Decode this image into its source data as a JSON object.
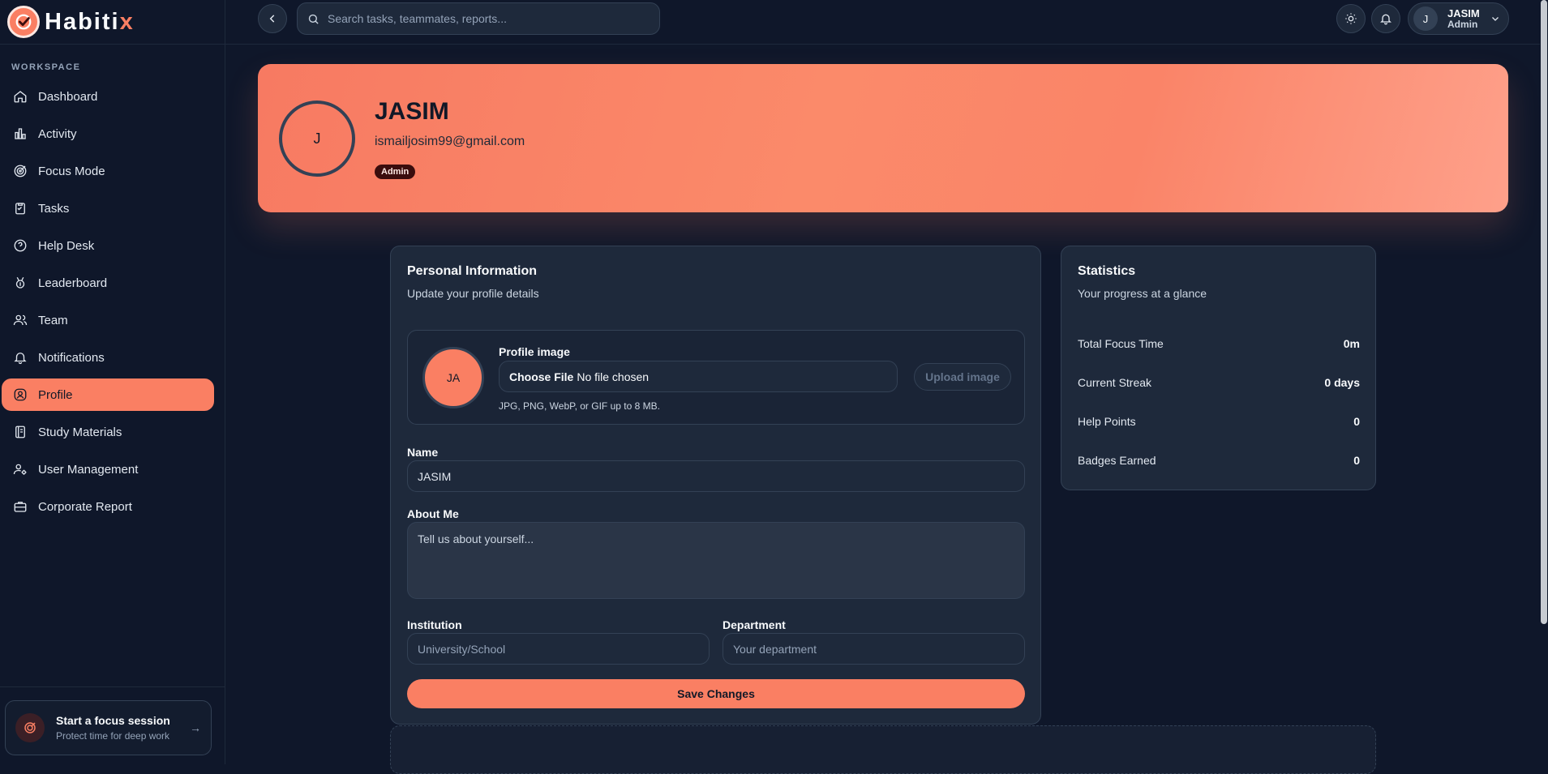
{
  "app": {
    "name_main": "Habiti",
    "name_accent": "x",
    "accent_color": "#fa7f63"
  },
  "sidebar": {
    "section_label": "WORKSPACE",
    "items": [
      {
        "label": "Dashboard",
        "icon": "home-icon"
      },
      {
        "label": "Activity",
        "icon": "bar-chart-icon"
      },
      {
        "label": "Focus Mode",
        "icon": "target-icon"
      },
      {
        "label": "Tasks",
        "icon": "clipboard-icon"
      },
      {
        "label": "Help Desk",
        "icon": "help-circle-icon"
      },
      {
        "label": "Leaderboard",
        "icon": "award-icon"
      },
      {
        "label": "Team",
        "icon": "users-icon"
      },
      {
        "label": "Notifications",
        "icon": "bell-icon"
      },
      {
        "label": "Profile",
        "icon": "user-circle-icon",
        "active": true
      },
      {
        "label": "Study Materials",
        "icon": "book-icon"
      },
      {
        "label": "User Management",
        "icon": "user-cog-icon"
      },
      {
        "label": "Corporate Report",
        "icon": "briefcase-icon"
      }
    ],
    "focus_card": {
      "title": "Start a focus session",
      "subtitle": "Protect time for deep work"
    }
  },
  "topbar": {
    "search_placeholder": "Search tasks, teammates, reports...",
    "user": {
      "initial": "J",
      "name": "JASIM",
      "role": "Admin"
    }
  },
  "hero": {
    "avatar_initial": "J",
    "name": "JASIM",
    "email": "ismailjosim99@gmail.com",
    "badge": "Admin"
  },
  "personal_info": {
    "title": "Personal Information",
    "subtitle": "Update your profile details",
    "profile_image": {
      "avatar_initials": "JA",
      "label": "Profile image",
      "choose_file": "Choose File",
      "no_file": "No file chosen",
      "upload_button": "Upload image",
      "hint": "JPG, PNG, WebP, or GIF up to 8 MB."
    },
    "name_label": "Name",
    "name_value": "JASIM",
    "about_label": "About Me",
    "about_placeholder": "Tell us about yourself...",
    "institution_label": "Institution",
    "institution_placeholder": "University/School",
    "department_label": "Department",
    "department_placeholder": "Your department",
    "save_button": "Save Changes"
  },
  "statistics": {
    "title": "Statistics",
    "subtitle": "Your progress at a glance",
    "rows": [
      {
        "label": "Total Focus Time",
        "value": "0m"
      },
      {
        "label": "Current Streak",
        "value": "0 days"
      },
      {
        "label": "Help Points",
        "value": "0"
      },
      {
        "label": "Badges Earned",
        "value": "0"
      }
    ]
  }
}
